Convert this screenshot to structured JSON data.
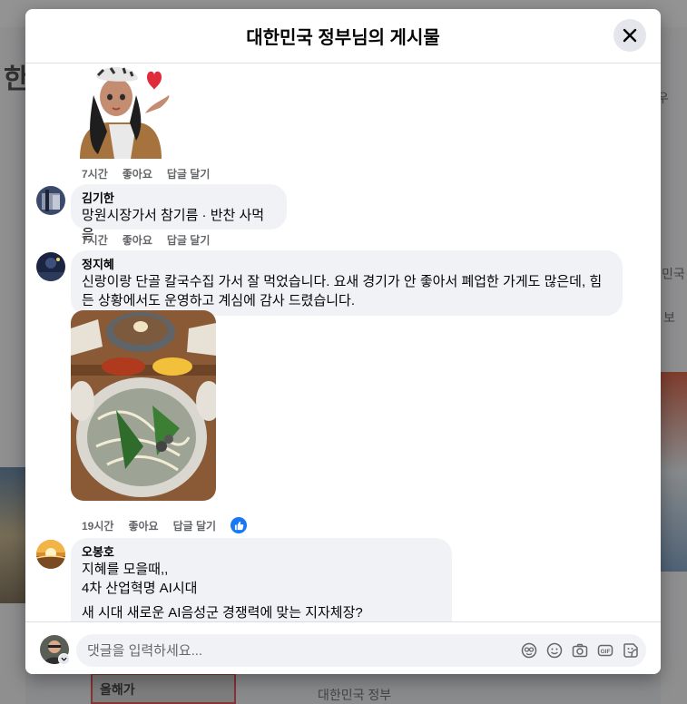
{
  "modal": {
    "title": "대한민국 정부님의 게시물",
    "close_icon": "close-icon"
  },
  "comments": [
    {
      "type": "sticker",
      "actions": {
        "time": "7시간",
        "like": "좋아요",
        "reply": "답글 달기"
      }
    },
    {
      "author": "김기한",
      "text": "망원시장가서 참기름 · 반찬 사먹음",
      "actions": {
        "time": "7시간",
        "like": "좋아요",
        "reply": "답글 달기"
      }
    },
    {
      "author": "정지혜",
      "text_line1": "신랑이랑 단골 칼국수집 가서 잘 먹었습니다. 요새 경기가 안 좋아서 폐업한 가게도 많은데, 힘",
      "text_line2": "든 상황에서도 운영하고 계심에 감사 드렸습니다.",
      "actions": {
        "time": "19시간",
        "like": "좋아요",
        "reply": "답글 달기"
      },
      "reaction_icon": "like-icon"
    },
    {
      "author": "오봉호",
      "line1": "지혜를 모을때,,",
      "line2": "4차 산업혁명 AI시대",
      "line3": "새 시대 새로운 AI음성군 경쟁력에 맞는 지자체장?"
    }
  ],
  "composer": {
    "placeholder": "댓글을 입력하세요...",
    "icons": [
      "avatar-sticker-icon",
      "emoji-icon",
      "camera-icon",
      "gif-icon",
      "sticker-icon"
    ]
  },
  "background": {
    "left_fragment_1": "한",
    "right_fragment_1": "우",
    "right_fragment_2": "민국",
    "right_fragment_3": "보",
    "bottom_fragment": "대한민국 정부",
    "bottom_box_label": "올해가"
  },
  "colors": {
    "accent": "#1877f2",
    "bubble": "#f0f2f5",
    "secondary_text": "#65676b"
  }
}
